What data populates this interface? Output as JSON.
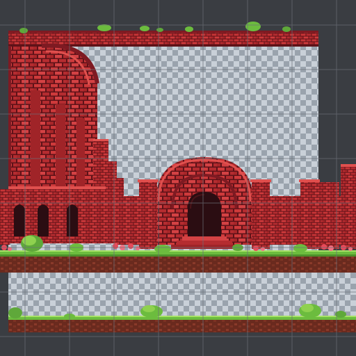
{
  "scene": {
    "type": "pixel-art tileset sheet",
    "palette": {
      "background": "#3a3d42",
      "grid_line": "#6b7078",
      "checker_light": "#c9d0d8",
      "checker_dark": "#9aa3ad",
      "brick_light": "#d43a3a",
      "brick_mid": "#b82b2f",
      "brick_dark": "#7e1a22",
      "mortar": "#5e1218",
      "grass_light": "#8fd14f",
      "grass_dark": "#4d8f2a",
      "soil": "#8a3a2a",
      "soil_dark": "#5e2418",
      "doorway": "#2b0d12",
      "flower": "#e84a5a"
    },
    "icons": {
      "tile_grid": "grid-icon",
      "bush": "bush-icon",
      "flower_patch": "flower-icon"
    }
  }
}
